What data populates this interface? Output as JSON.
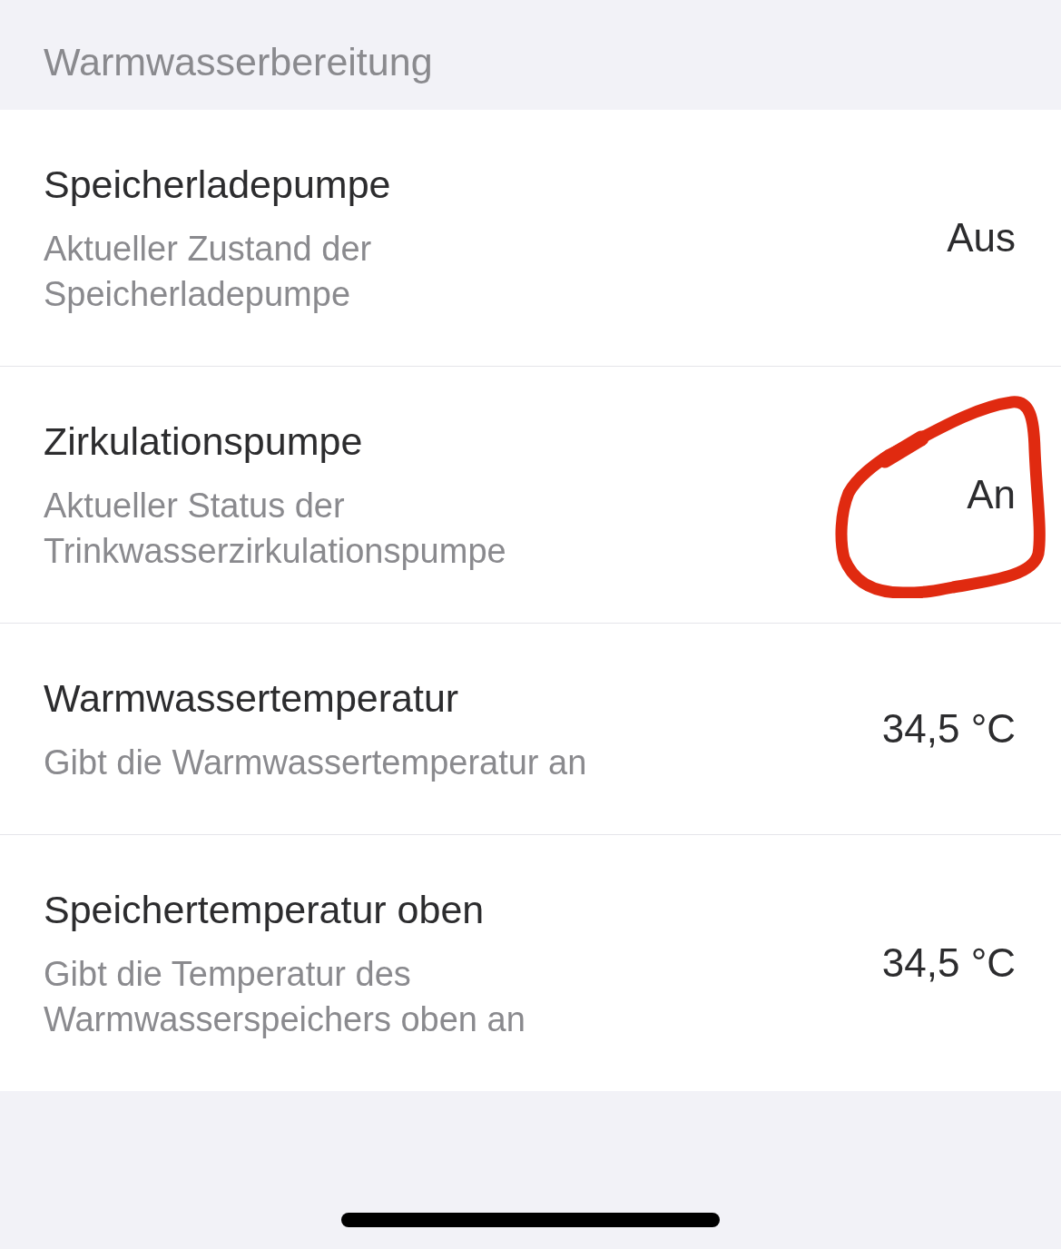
{
  "section": {
    "title": "Warmwasserbereitung"
  },
  "rows": [
    {
      "title": "Speicherladepumpe",
      "description": "Aktueller Zustand der Speicherladepumpe",
      "value": "Aus",
      "circled": false
    },
    {
      "title": "Zirkulationspumpe",
      "description": "Aktueller Status der Trinkwasserzirkulationspumpe",
      "value": "An",
      "circled": true
    },
    {
      "title": "Warmwassertemperatur",
      "description": "Gibt die Warmwassertemperatur an",
      "value": "34,5 °C",
      "circled": false
    },
    {
      "title": "Speichertemperatur oben",
      "description": "Gibt die Temperatur des Warmwasserspeichers oben an",
      "value": "34,5 °C",
      "circled": false
    }
  ]
}
